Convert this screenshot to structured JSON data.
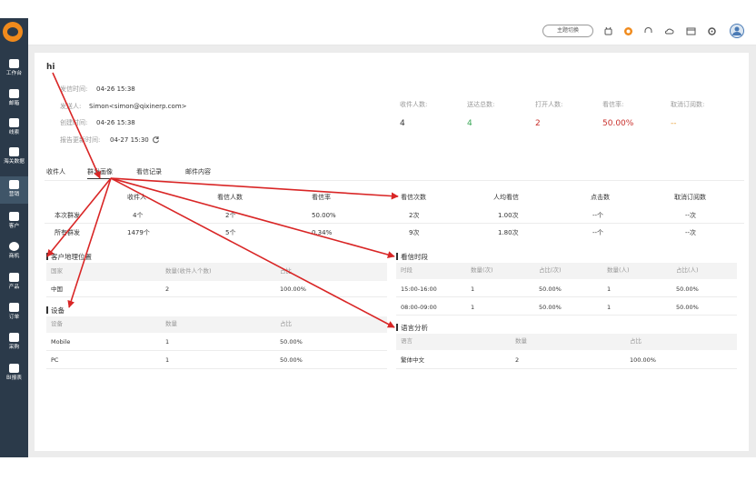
{
  "header": {
    "theme_btn": "主题切换"
  },
  "sidebar": {
    "items": [
      {
        "label": "工作台",
        "icon": "home-icon"
      },
      {
        "label": "邮箱",
        "icon": "mail-icon"
      },
      {
        "label": "线索",
        "icon": "clue-icon"
      },
      {
        "label": "海关数据",
        "icon": "anchor-icon"
      },
      {
        "label": "营销",
        "icon": "marketing-icon"
      },
      {
        "label": "客户",
        "icon": "customer-icon"
      },
      {
        "label": "商机",
        "icon": "bulb-icon"
      },
      {
        "label": "产品",
        "icon": "box-icon"
      },
      {
        "label": "订单",
        "icon": "order-icon"
      },
      {
        "label": "采购",
        "icon": "cart-icon"
      },
      {
        "label": "BI报表",
        "icon": "chart-icon"
      }
    ]
  },
  "mail": {
    "subject": "hi",
    "send_time_label": "发信时间:",
    "send_time": "04-26 15:38",
    "sender_label": "发送人:",
    "sender": "Simon<simon@qixinerp.com>",
    "created_label": "创建时间:",
    "created": "04-26 15:38",
    "report_label": "报告更新时间:",
    "report": "04-27 15:30"
  },
  "stats": [
    {
      "label": "收件人数:",
      "value": "4"
    },
    {
      "label": "送达总数:",
      "value": "4"
    },
    {
      "label": "打开人数:",
      "value": "2"
    },
    {
      "label": "看信率:",
      "value": "50.00%"
    },
    {
      "label": "取消订阅数:",
      "value": "--"
    }
  ],
  "tabs": [
    "收件人",
    "群发画像",
    "看信记录",
    "邮件内容"
  ],
  "summary": {
    "headers": [
      "收件人",
      "看信人数",
      "看信率",
      "看信次数",
      "人均看信",
      "点击数",
      "取消订阅数"
    ],
    "rows": [
      [
        "本次群发",
        "4个",
        "2个",
        "50.00%",
        "2次",
        "1.00次",
        "--个",
        "--次"
      ],
      [
        "所有群发",
        "1479个",
        "5个",
        "0.34%",
        "9次",
        "1.80次",
        "--个",
        "--次"
      ]
    ]
  },
  "location": {
    "title": "客户地理位置",
    "headers": [
      "国家",
      "数量(收件人个数)",
      "占比"
    ],
    "rows": [
      [
        "中国",
        "2",
        "100.00%"
      ]
    ]
  },
  "device": {
    "title": "设备",
    "headers": [
      "设备",
      "数量",
      "占比"
    ],
    "rows": [
      [
        "Mobile",
        "1",
        "50.00%"
      ],
      [
        "PC",
        "1",
        "50.00%"
      ]
    ]
  },
  "period": {
    "title": "看信时段",
    "headers": [
      "时段",
      "数量(次)",
      "占比(次)",
      "数量(人)",
      "占比(人)"
    ],
    "rows": [
      [
        "15:00-16:00",
        "1",
        "50.00%",
        "1",
        "50.00%"
      ],
      [
        "08:00-09:00",
        "1",
        "50.00%",
        "1",
        "50.00%"
      ]
    ]
  },
  "language": {
    "title": "语言分析",
    "headers": [
      "语言",
      "数量",
      "占比"
    ],
    "rows": [
      [
        "繁体中文",
        "2",
        "100.00%"
      ]
    ]
  },
  "colors": {
    "sidebar": "#2b3a4a",
    "green": "#3aa757",
    "red": "#c9302c",
    "orange": "#e8a23c",
    "arrow": "#d92626"
  }
}
